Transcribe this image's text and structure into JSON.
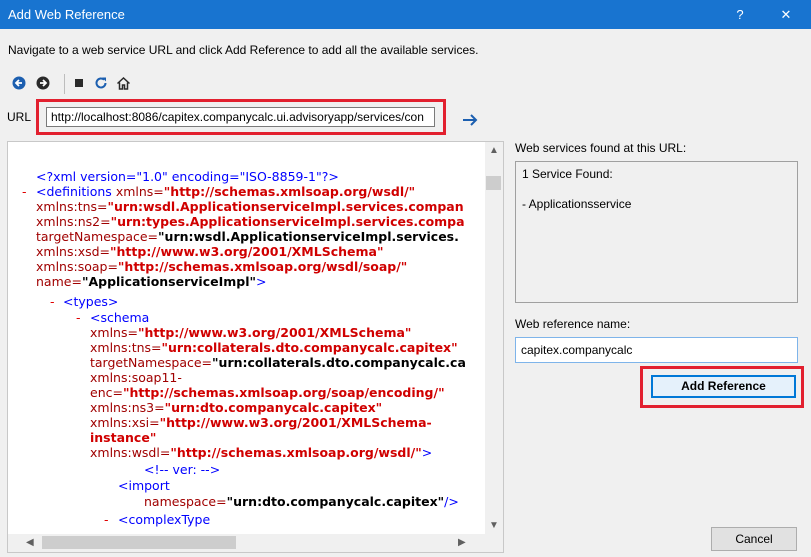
{
  "window": {
    "title": "Add Web Reference",
    "help_label": "?",
    "close_label": "✕"
  },
  "instructions": "Navigate to a web service URL and click Add Reference to add all the available services.",
  "url": {
    "label": "URL",
    "value": "http://localhost:8086/capitex.companycalc.ui.advisoryapp/services/con"
  },
  "xml_lines": {
    "l1": "<?xml version=\"1.0\" encoding=\"ISO-8859-1\"?>",
    "l2_tag": "<definitions",
    "l2_attr": "xmlns=",
    "l2_val": "\"http://schemas.xmlsoap.org/wsdl/\"",
    "l3_attr": "xmlns:tns=",
    "l3_val": "\"urn:wsdl.ApplicationserviceImpl.services.compan",
    "l4_attr": "xmlns:ns2=",
    "l4_val": "\"urn:types.ApplicationserviceImpl.services.compa",
    "l5_attr": "targetNamespace=",
    "l5_val": "\"urn:wsdl.ApplicationserviceImpl.services.",
    "l6_attr": "xmlns:xsd=",
    "l6_val": "\"http://www.w3.org/2001/XMLSchema\"",
    "l7_attr": "xmlns:soap=",
    "l7_val": "\"http://schemas.xmlsoap.org/wsdl/soap/\"",
    "l8_attr": "name=",
    "l8_val": "\"ApplicationserviceImpl\"",
    "l8_end": ">",
    "l9": "<types>",
    "l10": "<schema",
    "l11_attr": "xmlns=",
    "l11_val": "\"http://www.w3.org/2001/XMLSchema\"",
    "l12_attr": "xmlns:tns=",
    "l12_val": "\"urn:collaterals.dto.companycalc.capitex\"",
    "l13_attr": "targetNamespace=",
    "l13_val": "\"urn:collaterals.dto.companycalc.ca",
    "l14_attr": "xmlns:soap11-",
    "l15_attr": "enc=",
    "l15_val": "\"http://schemas.xmlsoap.org/soap/encoding/\"",
    "l16_attr": "xmlns:ns3=",
    "l16_val": "\"urn:dto.companycalc.capitex\"",
    "l17_attr": "xmlns:xsi=",
    "l17_val": "\"http://www.w3.org/2001/XMLSchema-",
    "l18_val": "instance\"",
    "l19_attr": "xmlns:wsdl=",
    "l19_val": "\"http://schemas.xmlsoap.org/wsdl/\"",
    "l19_end": ">",
    "l20": "<!-- ver: -->",
    "l21": "<import",
    "l22_attr": "namespace=",
    "l22_val": "\"urn:dto.companycalc.capitex\"",
    "l22_end": "/>",
    "l23": "<complexType",
    "dash": "-"
  },
  "services": {
    "label": "Web services found at this URL:",
    "count_text": "1 Service Found:",
    "items": [
      "- Applicationsservice"
    ]
  },
  "reference": {
    "label": "Web reference name:",
    "value": "capitex.companycalc"
  },
  "buttons": {
    "add_reference": "Add Reference",
    "cancel": "Cancel"
  },
  "colors": {
    "titlebar": "#1874d0",
    "highlight": "#e2202f",
    "xml_tag": "#0000ff",
    "xml_value": "#d00000"
  }
}
